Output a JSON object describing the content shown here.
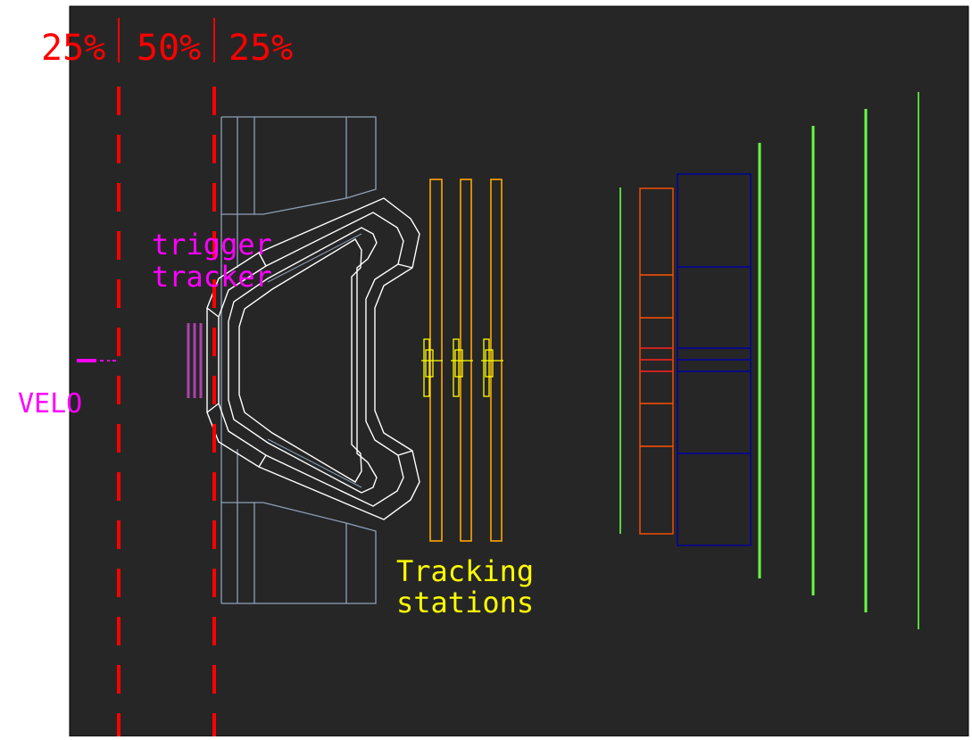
{
  "labels": {
    "pct_left": "25%",
    "pct_mid": "50%",
    "pct_right": "25%",
    "velo": "VELO",
    "trigger_line1": "trigger",
    "trigger_line2": "tracker",
    "tracking_line1": "Tracking",
    "tracking_line2": "stations"
  },
  "colors": {
    "background": "#262626",
    "page": "#ffffff",
    "cut_lines": "#ff0000",
    "magnet": "#8ea0b8",
    "magnet_coil": "#ffffff",
    "velo": "#ff00ff",
    "trigger_tracker": "#b040b0",
    "tracking_stations": "#ffa500",
    "inner_tracker": "#ffff00",
    "calorimeter": "#ff5000",
    "hcal": "#0000a0",
    "muon": "#66ff44"
  }
}
